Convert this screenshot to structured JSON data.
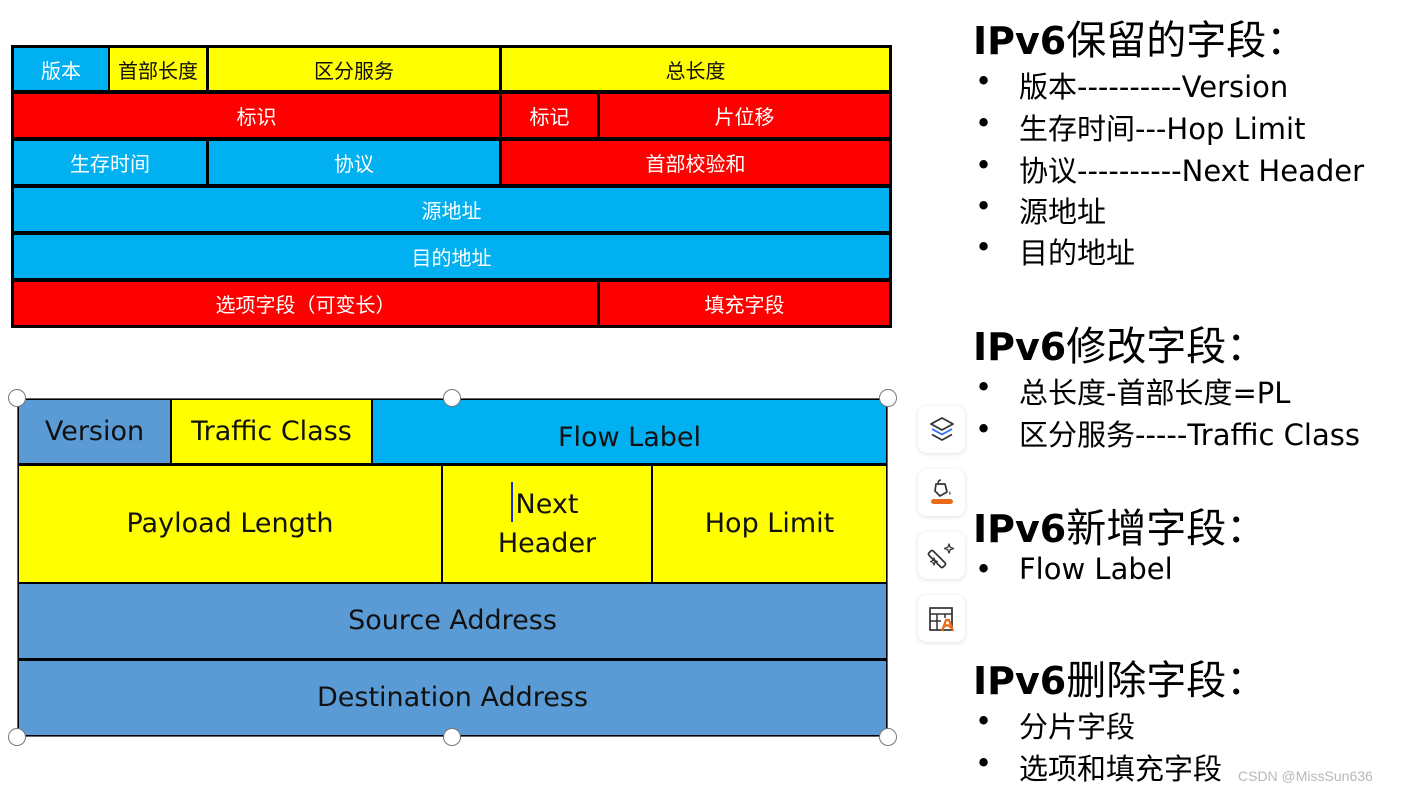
{
  "ipv4_header": {
    "rows": [
      [
        {
          "label": "版本",
          "color": "cyan"
        },
        {
          "label": "首部长度",
          "color": "yellow"
        },
        {
          "label": "区分服务",
          "color": "yellow"
        },
        {
          "label": "总长度",
          "color": "yellow"
        }
      ],
      [
        {
          "label": "标识",
          "color": "red"
        },
        {
          "label": "标记",
          "color": "red"
        },
        {
          "label": "片位移",
          "color": "red"
        }
      ],
      [
        {
          "label": "生存时间",
          "color": "cyan"
        },
        {
          "label": "协议",
          "color": "cyan"
        },
        {
          "label": "首部校验和",
          "color": "red"
        }
      ],
      [
        {
          "label": "源地址",
          "color": "cyan"
        }
      ],
      [
        {
          "label": "目的地址",
          "color": "cyan"
        }
      ],
      [
        {
          "label": "选项字段（可变长）",
          "color": "red"
        },
        {
          "label": "填充字段",
          "color": "red"
        }
      ]
    ]
  },
  "ipv6_header": {
    "rows": [
      [
        {
          "label": "Version",
          "color": "steel"
        },
        {
          "label": "Traffic Class",
          "color": "yellow"
        },
        {
          "label": "Flow Label",
          "color": "cyan"
        }
      ],
      [
        {
          "label": "Payload Length",
          "color": "yellow"
        },
        {
          "label": "Next Header",
          "line1": "Next",
          "line2": "Header",
          "color": "yellow"
        },
        {
          "label": "Hop Limit",
          "color": "yellow"
        }
      ],
      [
        {
          "label": "Source Address",
          "color": "steel"
        }
      ],
      [
        {
          "label": "Destination Address",
          "color": "steel"
        }
      ]
    ]
  },
  "colors": {
    "cyan": "#00b0f0",
    "yellow": "#ffff00",
    "red": "#ff0000",
    "steel": "#5b9bd5",
    "toolbar_accent_blue": "#2f6bff",
    "toolbar_accent_orange": "#e86a1a"
  },
  "toolbar": [
    {
      "icon": "layers-icon",
      "label": "Arrange layers"
    },
    {
      "icon": "paint-bucket-icon",
      "label": "Fill color"
    },
    {
      "icon": "magic-wand-icon",
      "label": "Design ideas"
    },
    {
      "icon": "table-style-icon",
      "label": "Table style"
    }
  ],
  "notes": {
    "sections": [
      {
        "prefix": "IPv6",
        "title": "保留的字段：",
        "items": [
          "版本----------Version",
          "生存时间---Hop Limit",
          "协议----------Next Header",
          "源地址",
          "目的地址"
        ]
      },
      {
        "prefix": "IPv6",
        "title": "修改字段：",
        "items": [
          "总长度-首部长度=PL",
          "区分服务-----Traffic Class"
        ]
      },
      {
        "prefix": "IPv6",
        "title": "新增字段：",
        "items": [
          "Flow Label"
        ]
      },
      {
        "prefix": "IPv6",
        "title": "删除字段：",
        "items": [
          "分片字段",
          "选项和填充字段"
        ]
      }
    ],
    "bullet_char": "•"
  },
  "watermark": "CSDN @MissSun636"
}
